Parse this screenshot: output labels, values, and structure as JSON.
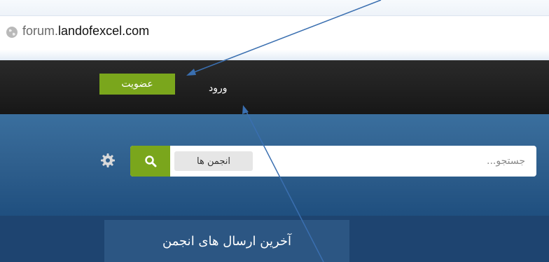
{
  "browser": {
    "url_prefix": "forum.",
    "url_domain": "landofexcel.com"
  },
  "navbar": {
    "join_label": "عضویت",
    "login_label": "ورود"
  },
  "search": {
    "placeholder": "جستجو...",
    "scope_label": "انجمن ها"
  },
  "subnav": {
    "latest_posts_label": "آخرین ارسال های انجمن"
  },
  "colors": {
    "accent_green": "#7aa61c",
    "navbar_bg": "#1c1c1c",
    "header_blue": "#2f5f8d",
    "subnav_blue": "#1e4470",
    "annotation_arrow": "#3a6fb0"
  }
}
